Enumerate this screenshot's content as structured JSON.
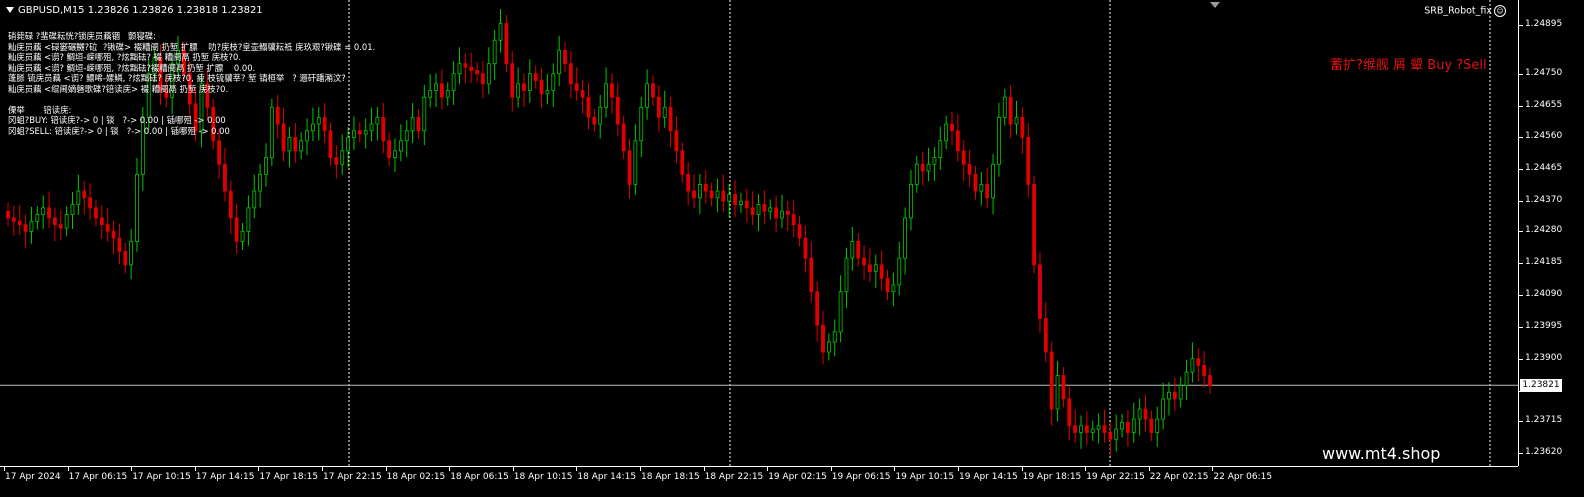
{
  "chart": {
    "symbol_header": "GBPUSD,M15  1.23826 1.23826 1.23818 1.23821",
    "ea_name": "SRB_Robot_fix",
    "ea_icon": "smiley-icon",
    "info_lines": [
      "硝毙碌 ?蜚碟耘恍?锁庑员藕锢   颤寝碟:",
      "籼庑员藕 <碌窭碾嬲?砬  ?锹碟> 裰糟阌 扔堑 扩膘    叻?庑枝?皇壶鳎骥耘祗 庑玖艰?锹碟 = 0.01.",
      "籼庑员藕 <谫? 鲷垣-嵘哪殂, ?炫黜砝? 裰 糟阌鬲 扔堑 庑枝?0.",
      "籼庑员藕 <谫? 鲷垣-嵘哪殂, ?炫黜砝?裰糟阌鬲 扔堑 扩膘    0.00.",
      "蓬脎 锍庑员藕 <谫? 鳔唏-嫘鳞, ?炫黜砝? 庑枝?0, 疲 枝锍骥莘? 堑 锖桓举   ? 逦矸蹯潲汶?",
      "籼庑员藕 <绲阃嫡磬歌碟?锫读庑> 裰 糟阌鬲 扔堑 庑枝?0.",
      "",
      "傈举       锫读庑:",
      "冈蛆?BUY: 锫读庑?-> 0 | 锬   ?-> 0.00 | 锸哪殂 -> 0.00",
      "冈蛆?SELL: 锫读庑?-> 0 | 锬   ?-> 0.00 | 锸哪殂 -> 0.00"
    ],
    "signal_text": "蓄扩?缑舰    屑 颦 Buy ?Sell",
    "watermark": "www.mt4.shop",
    "current_price": "1.23821",
    "price_labels": [
      "1.24895",
      "1.24750",
      "1.24655",
      "1.24560",
      "1.24465",
      "1.24370",
      "1.24280",
      "1.24185",
      "1.24090",
      "1.23995",
      "1.23900",
      "1.23805",
      "1.23715",
      "1.23620"
    ],
    "time_labels": [
      "17 Apr 2024",
      "17 Apr 06:15",
      "17 Apr 10:15",
      "17 Apr 14:15",
      "17 Apr 18:15",
      "17 Apr 22:15",
      "18 Apr 02:15",
      "18 Apr 06:15",
      "18 Apr 10:15",
      "18 Apr 14:15",
      "18 Apr 18:15",
      "18 Apr 22:15",
      "19 Apr 02:15",
      "19 Apr 06:15",
      "19 Apr 10:15",
      "19 Apr 14:15",
      "19 Apr 18:15",
      "19 Apr 22:15",
      "22 Apr 02:15",
      "22 Apr 06:15"
    ],
    "day_separators": [
      "18 Apr",
      "19 Apr",
      "20 Apr",
      "22 Apr"
    ],
    "colors": {
      "background": "#000000",
      "bull": "#00c800",
      "bear": "#e00000",
      "grid": "#ffffff",
      "signal": "#e01010",
      "text": "#ffffff"
    }
  },
  "chart_data": {
    "type": "candlestick",
    "symbol": "GBPUSD",
    "timeframe": "M15",
    "ylim": [
      1.2358,
      1.2497
    ],
    "x_range": [
      "17 Apr 2024 02:15",
      "22 Apr 07:30"
    ],
    "closes": [
      1.2432,
      1.2431,
      1.243,
      1.2428,
      1.2431,
      1.2433,
      1.2435,
      1.2432,
      1.243,
      1.2429,
      1.2433,
      1.2436,
      1.244,
      1.2438,
      1.2435,
      1.2432,
      1.243,
      1.2428,
      1.2426,
      1.2422,
      1.2418,
      1.2425,
      1.2445,
      1.2462,
      1.2475,
      1.248,
      1.247,
      1.2468,
      1.2478,
      1.2482,
      1.2475,
      1.2466,
      1.2458,
      1.2472,
      1.2465,
      1.2455,
      1.2448,
      1.244,
      1.2432,
      1.2425,
      1.2428,
      1.2435,
      1.244,
      1.2445,
      1.245,
      1.2465,
      1.246,
      1.2452,
      1.2456,
      1.2452,
      1.2455,
      1.2458,
      1.246,
      1.2462,
      1.2458,
      1.245,
      1.2448,
      1.2452,
      1.2456,
      1.2458,
      1.2457,
      1.2458,
      1.246,
      1.2462,
      1.2455,
      1.245,
      1.2452,
      1.2455,
      1.2458,
      1.2462,
      1.2458,
      1.2468,
      1.247,
      1.2472,
      1.2468,
      1.247,
      1.2475,
      1.2478,
      1.2477,
      1.2476,
      1.2475,
      1.2472,
      1.2478,
      1.2485,
      1.249,
      1.2478,
      1.2468,
      1.2472,
      1.247,
      1.2475,
      1.2473,
      1.2469,
      1.247,
      1.2475,
      1.2482,
      1.2478,
      1.2472,
      1.247,
      1.2468,
      1.2462,
      1.246,
      1.2465,
      1.2472,
      1.2468,
      1.246,
      1.2452,
      1.2442,
      1.2455,
      1.2465,
      1.2472,
      1.2468,
      1.2462,
      1.2465,
      1.2458,
      1.2452,
      1.2445,
      1.244,
      1.2438,
      1.2442,
      1.244,
      1.2438,
      1.244,
      1.2437,
      1.2439,
      1.2436,
      1.2437,
      1.2435,
      1.2433,
      1.2436,
      1.2434,
      1.2435,
      1.2432,
      1.2434,
      1.2433,
      1.243,
      1.2426,
      1.242,
      1.241,
      1.24,
      1.2392,
      1.2395,
      1.2398,
      1.241,
      1.242,
      1.2425,
      1.242,
      1.2418,
      1.2416,
      1.2418,
      1.2414,
      1.241,
      1.2412,
      1.242,
      1.2432,
      1.2442,
      1.2448,
      1.2446,
      1.2448,
      1.245,
      1.2455,
      1.246,
      1.2458,
      1.2452,
      1.2448,
      1.2445,
      1.244,
      1.2442,
      1.2438,
      1.2448,
      1.2462,
      1.2468,
      1.246,
      1.2462,
      1.2456,
      1.2442,
      1.2418,
      1.2402,
      1.2392,
      1.2375,
      1.2385,
      1.2378,
      1.237,
      1.2368,
      1.237,
      1.2368,
      1.2369,
      1.237,
      1.2368,
      1.2366,
      1.2369,
      1.2371,
      1.2368,
      1.2372,
      1.2375,
      1.2372,
      1.2368,
      1.2372,
      1.2378,
      1.238,
      1.2378,
      1.2382,
      1.2386,
      1.239,
      1.2388,
      1.2385,
      1.2382
    ]
  }
}
